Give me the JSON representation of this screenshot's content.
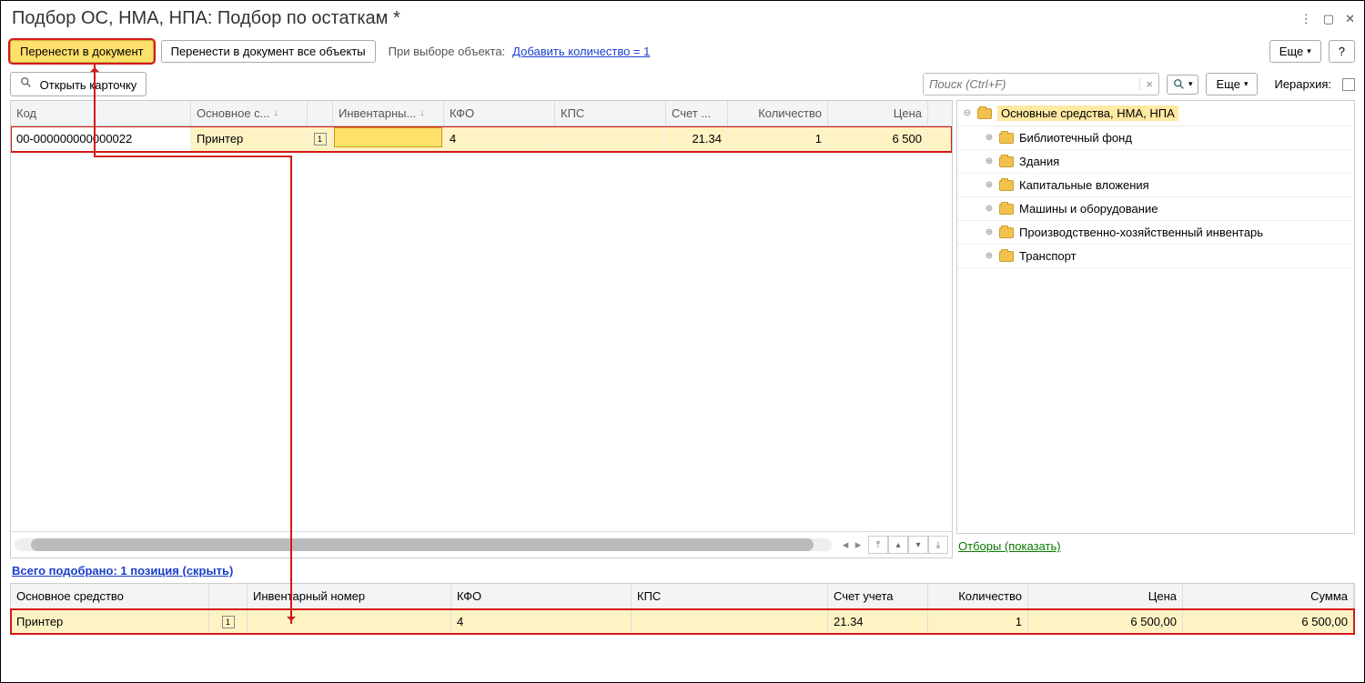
{
  "title": "Подбор ОС, НМА, НПА: Подбор по остаткам *",
  "toolbar1": {
    "transfer": "Перенести в документ",
    "transfer_all": "Перенести в документ все объекты",
    "on_select_label": "При выборе объекта:",
    "add_qty_link": "Добавить количество = 1",
    "more": "Еще",
    "help": "?"
  },
  "toolbar2": {
    "open_card": "Открыть карточку",
    "search_placeholder": "Поиск (Ctrl+F)",
    "more": "Еще",
    "hierarchy_label": "Иерархия:"
  },
  "grid": {
    "headers": {
      "code": "Код",
      "osnovnoe": "Основное с...",
      "inventory": "Инвентарны...",
      "kfo": "КФО",
      "kps": "КПС",
      "account": "Счет ...",
      "qty": "Количество",
      "price": "Цена"
    },
    "row": {
      "code": "00-000000000000022",
      "osnovnoe": "Принтер",
      "inventory": "",
      "kfo": "4",
      "kps": "",
      "account": "21.34",
      "qty": "1",
      "price": "6 500"
    }
  },
  "tree": {
    "root": "Основные средства, НМА, НПА",
    "items": [
      "Библиотечный фонд",
      "Здания",
      "Капитальные вложения",
      "Машины и оборудование",
      "Производственно-хозяйственный инвентарь",
      "Транспорт"
    ]
  },
  "filters_link": "Отборы (показать)",
  "summary_link": "Всего подобрано: 1 позиция (скрыть)",
  "selected": {
    "headers": {
      "osnovnoe": "Основное средство",
      "inventory": "Инвентарный номер",
      "kfo": "КФО",
      "kps": "КПС",
      "account": "Счет учета",
      "qty": "Количество",
      "price": "Цена",
      "sum": "Сумма"
    },
    "row": {
      "osnovnoe": "Принтер",
      "inventory": "",
      "kfo": "4",
      "kps": "",
      "account": "21.34",
      "qty": "1",
      "price": "6 500,00",
      "sum": "6 500,00"
    }
  }
}
